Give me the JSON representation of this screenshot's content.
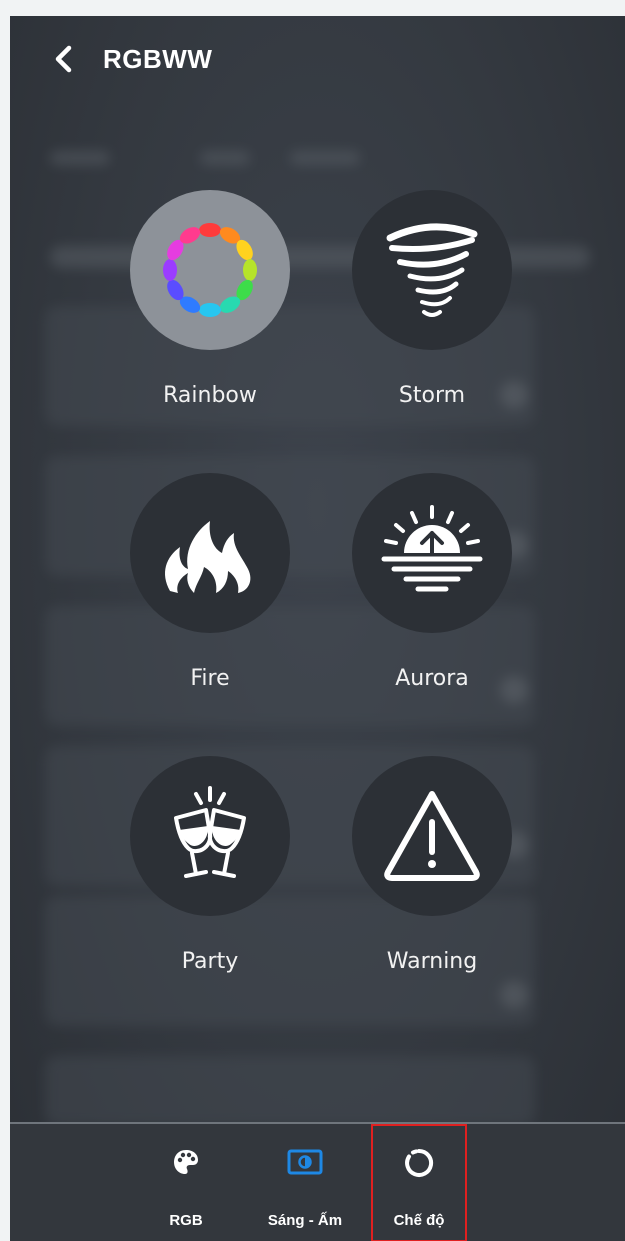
{
  "header": {
    "back_icon": "chevron-left-icon",
    "title": "RGBWW"
  },
  "effects": [
    {
      "label": "Rainbow",
      "icon": "rainbow-ring-icon",
      "selected": true
    },
    {
      "label": "Storm",
      "icon": "tornado-icon",
      "selected": false
    },
    {
      "label": "Fire",
      "icon": "flame-icon",
      "selected": false
    },
    {
      "label": "Aurora",
      "icon": "sunrise-icon",
      "selected": false
    },
    {
      "label": "Party",
      "icon": "wine-glasses-toast-icon",
      "selected": false
    },
    {
      "label": "Warning",
      "icon": "warning-triangle-icon",
      "selected": false
    }
  ],
  "tabbar": {
    "tabs": [
      {
        "label": "RGB",
        "icon": "palette-icon"
      },
      {
        "label": "Sáng - Ấm",
        "icon": "brightness-icon"
      },
      {
        "label": "Chế độ",
        "icon": "mode-ring-icon",
        "highlighted": true
      }
    ]
  },
  "colors": {
    "highlight_box": "#e02020",
    "selected_circle": "#8d9299",
    "circle": "#2c3036",
    "brightness_icon": "#1e88e5"
  }
}
